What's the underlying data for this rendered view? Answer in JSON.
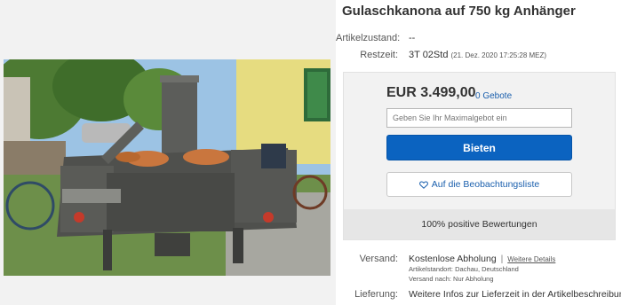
{
  "listing": {
    "title": "Gulaschkanona auf 750 kg Anhänger",
    "condition_label": "Artikelzustand:",
    "condition_value": "--",
    "time_left_label": "Restzeit:",
    "time_left_value": "3T 02Std",
    "end_date": "(21. Dez. 2020 17:25:28 MEZ)"
  },
  "bid": {
    "price": "EUR 3.499,00",
    "bids_count": "0 Gebote",
    "max_bid_placeholder": "Geben Sie Ihr Maximalgebot ein",
    "bid_button": "Bieten",
    "watch_button": "Auf die Beobachtungsliste",
    "feedback": "100% positive Bewertungen",
    "colors": {
      "bid_button": "#0b63c0",
      "link": "#1a5fad"
    }
  },
  "shipping": {
    "label": "Versand:",
    "value": "Kostenlose Abholung",
    "details_link": "Weitere Details",
    "location": "Artikelstandort: Dachau, Deutschland",
    "ships_to": "Versand nach: Nur Abholung"
  },
  "delivery": {
    "label": "Lieferung:",
    "value": "Weitere Infos zur Lieferzeit in der Artikelbeschreibung"
  },
  "icons": {
    "watch": "heart-icon"
  }
}
